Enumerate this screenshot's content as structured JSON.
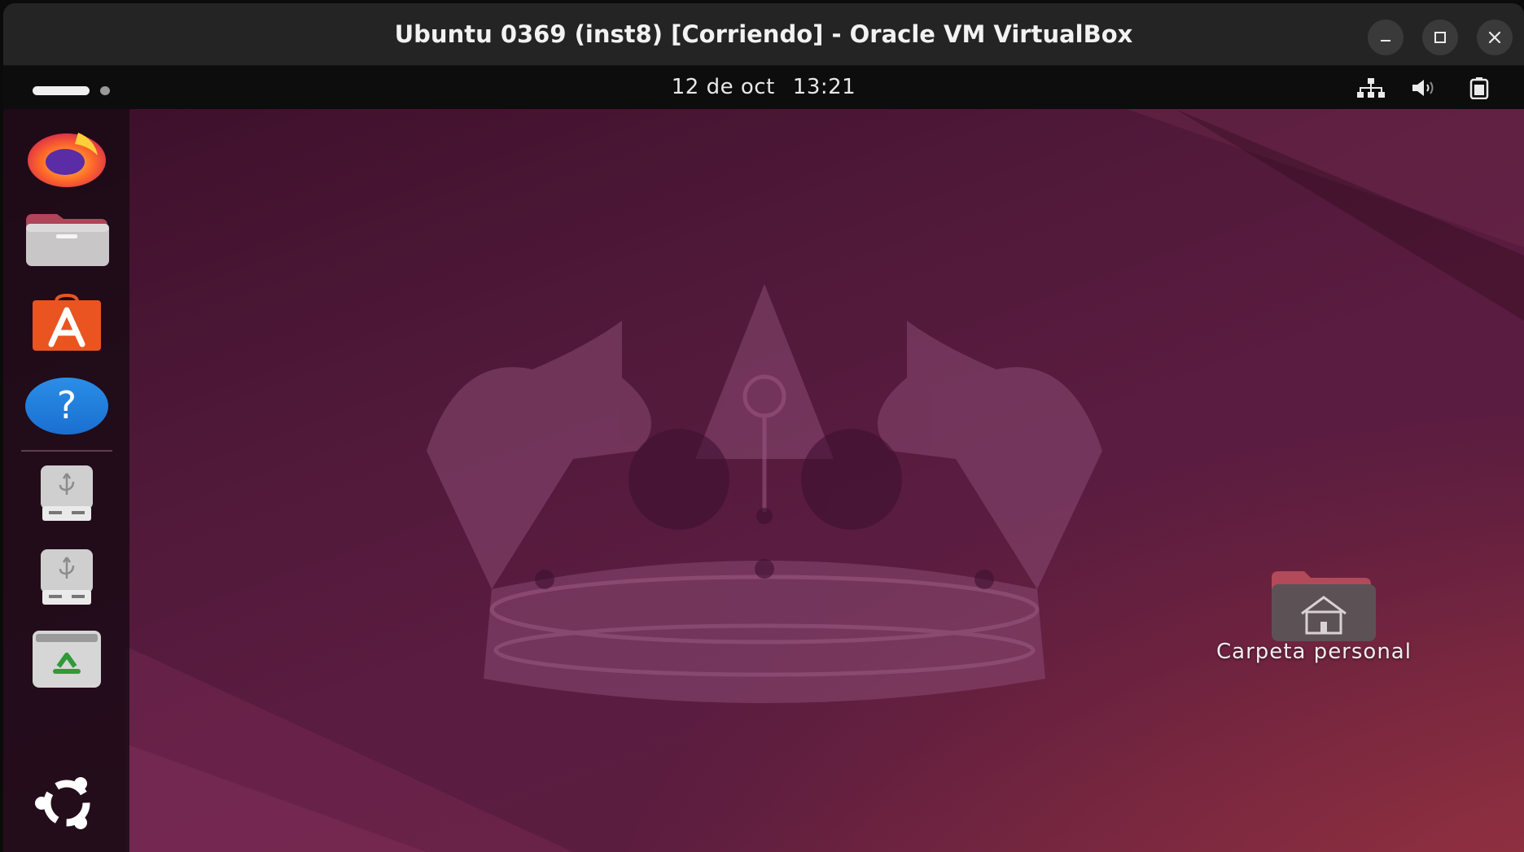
{
  "window": {
    "title": "Ubuntu 0369 (inst8) [Corriendo] - Oracle VM VirtualBox",
    "controls": [
      "minimize-icon",
      "maximize-icon",
      "close-icon"
    ]
  },
  "top_panel": {
    "date": "12 de oct",
    "time": "13:21",
    "tray_icons": [
      "network-icon",
      "volume-icon",
      "battery-icon"
    ]
  },
  "dock": {
    "items": [
      {
        "name": "firefox",
        "icon": "firefox-icon"
      },
      {
        "name": "files",
        "icon": "files-folder-icon"
      },
      {
        "name": "app-center",
        "icon": "app-center-icon"
      },
      {
        "name": "help",
        "icon": "help-icon"
      },
      {
        "name": "usb-drive-1",
        "icon": "usb-drive-icon"
      },
      {
        "name": "usb-drive-2",
        "icon": "usb-drive-icon"
      },
      {
        "name": "trash",
        "icon": "trash-icon"
      },
      {
        "name": "show-apps",
        "icon": "ubuntu-logo-icon"
      }
    ]
  },
  "desktop": {
    "icons": [
      {
        "label": "Carpeta personal",
        "icon": "home-folder-icon"
      }
    ]
  },
  "colors": {
    "titlebar": "#242424",
    "panel": "#0d0d0d",
    "wallpaper": "#5a1c40",
    "accent_orange": "#e95420"
  }
}
